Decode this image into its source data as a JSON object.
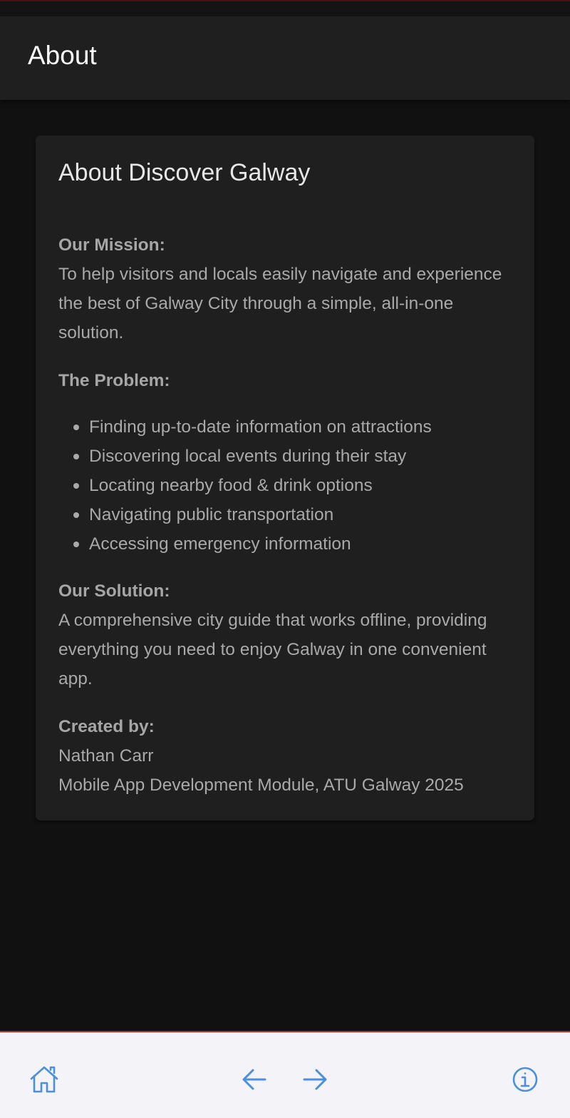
{
  "header": {
    "title": "About"
  },
  "card": {
    "title": "About Discover Galway",
    "mission_heading": "Our Mission:",
    "mission_text": "To help visitors and locals easily navigate and experience the best of Galway City through a simple, all-in-one solution.",
    "problem_heading": "The Problem:",
    "problems": [
      "Finding up-to-date information on attractions",
      "Discovering local events during their stay",
      "Locating nearby food & drink options",
      "Navigating public transportation",
      "Accessing emergency information"
    ],
    "solution_heading": "Our Solution:",
    "solution_text": "A comprehensive city guide that works offline, providing everything you need to enjoy Galway in one convenient app.",
    "created_heading": "Created by:",
    "author": "Nathan Carr",
    "module": "Mobile App Development Module, ATU Galway 2025"
  },
  "bottom_nav": {
    "icons": [
      "home-icon",
      "arrow-back-icon",
      "arrow-forward-icon",
      "info-icon"
    ],
    "icon_color": "#4a8fe0"
  },
  "colors": {
    "background": "#111112",
    "toolbar": "#1f1f1f",
    "card": "#1f1f20",
    "bottom_bar": "#f4f4f8",
    "accent_line": "#b83838"
  }
}
